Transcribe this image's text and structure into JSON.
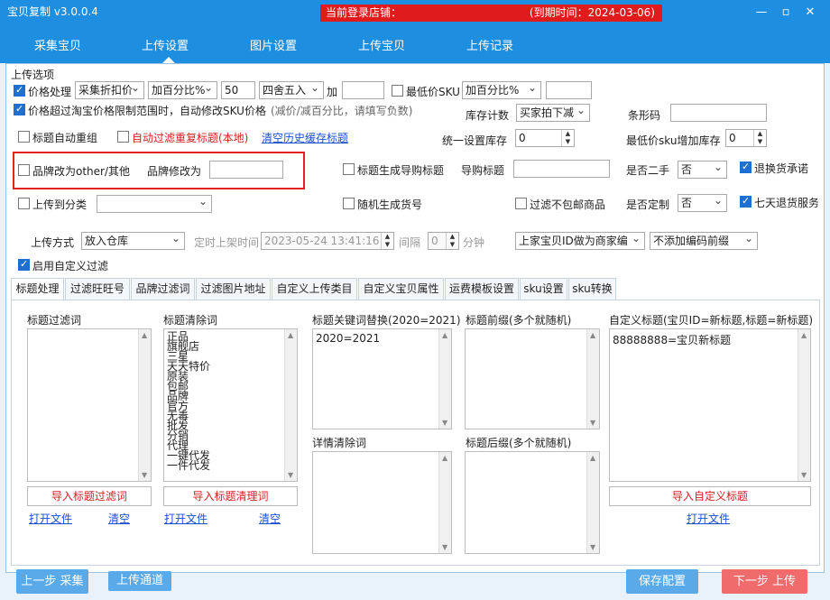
{
  "window": {
    "title": "宝贝复制 v3.0.0.4",
    "store_label": "当前登录店铺：",
    "expiry": "(到期时间：2024-03-06)"
  },
  "nav": {
    "tabs": [
      "采集宝贝",
      "上传设置",
      "图片设置",
      "上传宝贝",
      "上传记录"
    ],
    "active": "上传设置"
  },
  "upload_options": {
    "group_label": "上传选项",
    "price_process": {
      "label": "价格处理",
      "checked": true,
      "mode": "采集折扣价",
      "calc": "加百分比%",
      "value": "50",
      "rounding": "四舍五入",
      "plus_label": "加",
      "plus_value": ""
    },
    "min_price_sku": {
      "label": "最低价SKU",
      "checked": false,
      "calc": "加百分比%",
      "value": ""
    },
    "auto_fix_sku": {
      "label": "价格超过淘宝价格限制范围时，自动修改SKU价格",
      "hint": "(减价/减百分比，请填写负数)",
      "checked": true
    },
    "stock_count": {
      "label": "库存计数",
      "value": "买家拍下减"
    },
    "barcode": {
      "label": "条形码",
      "value": ""
    },
    "auto_title_reorg": {
      "label": "标题自动重组",
      "checked": false
    },
    "auto_filter_dup": {
      "label": "自动过滤重复标题(本地)",
      "checked": false
    },
    "clear_history": "清空历史缓存标题",
    "unified_stock": {
      "label": "统一设置库存",
      "value": "0"
    },
    "min_sku_stock": {
      "label": "最低价sku增加库存",
      "value": "0"
    },
    "brand_other": {
      "label": "品牌改为other/其他",
      "checked": false
    },
    "brand_change": {
      "label": "品牌修改为",
      "value": ""
    },
    "title_guide": {
      "label": "标题生成导购标题",
      "checked": false
    },
    "guide_title": {
      "label": "导购标题",
      "value": ""
    },
    "second_hand": {
      "label": "是否二手",
      "value": "否"
    },
    "return_commit": {
      "label": "退换货承诺",
      "checked": true
    },
    "upload_category": {
      "label": "上传到分类",
      "checked": false,
      "value": ""
    },
    "random_sku_no": {
      "label": "随机生成货号",
      "checked": false
    },
    "skip_no_free_ship": {
      "label": "过滤不包邮商品",
      "checked": false
    },
    "custom_made": {
      "label": "是否定制",
      "value": "否"
    },
    "seven_day_return": {
      "label": "七天退货服务",
      "checked": true
    },
    "upload_method": {
      "label": "上传方式",
      "value": "放入仓库"
    },
    "scheduled": {
      "label": "定时上架时间",
      "value": "2023-05-24 13:41:16",
      "interval_label": "间隔",
      "interval": "0",
      "unit": "分钟"
    },
    "merchant_code": "上家宝贝ID做为商家编",
    "code_prefix": "不添加编码前缀",
    "custom_filter": {
      "label": "启用自定义过滤",
      "checked": true
    }
  },
  "subtabs": [
    "标题处理",
    "过滤旺旺号",
    "品牌过滤词",
    "过滤图片地址",
    "自定义上传类目",
    "自定义宝贝属性",
    "运费模板设置",
    "sku设置",
    "sku转换"
  ],
  "title_panel": {
    "filter_words": {
      "label": "标题过滤词",
      "import": "导入标题过滤词",
      "open": "打开文件",
      "clear": "清空"
    },
    "clean_words": {
      "label": "标题清除词",
      "items": [
        "正品",
        "旗舰店",
        "三星",
        "天天特价",
        "原装",
        "包邮",
        "品牌",
        "官方",
        "无毒",
        "批发",
        "分销",
        "代理",
        "一键代发",
        "一件代发"
      ],
      "import": "导入标题清理词",
      "open": "打开文件",
      "clear": "清空"
    },
    "keyword_replace": {
      "label": "标题关键词替换(2020=2021)",
      "value": "2020=2021"
    },
    "detail_clear": {
      "label": "详情清除词"
    },
    "title_prefix": {
      "label": "标题前缀(多个就随机)"
    },
    "title_suffix": {
      "label": "标题后缀(多个就随机)"
    },
    "custom_title": {
      "label": "自定义标题(宝贝ID=新标题,标题=新标题)",
      "value": "88888888=宝贝新标题",
      "import": "导入自定义标题",
      "open": "打开文件"
    }
  },
  "bottom": {
    "prev": "上一步 采集",
    "channel": "上传通道",
    "save": "保存配置",
    "next": "下一步 上传"
  }
}
